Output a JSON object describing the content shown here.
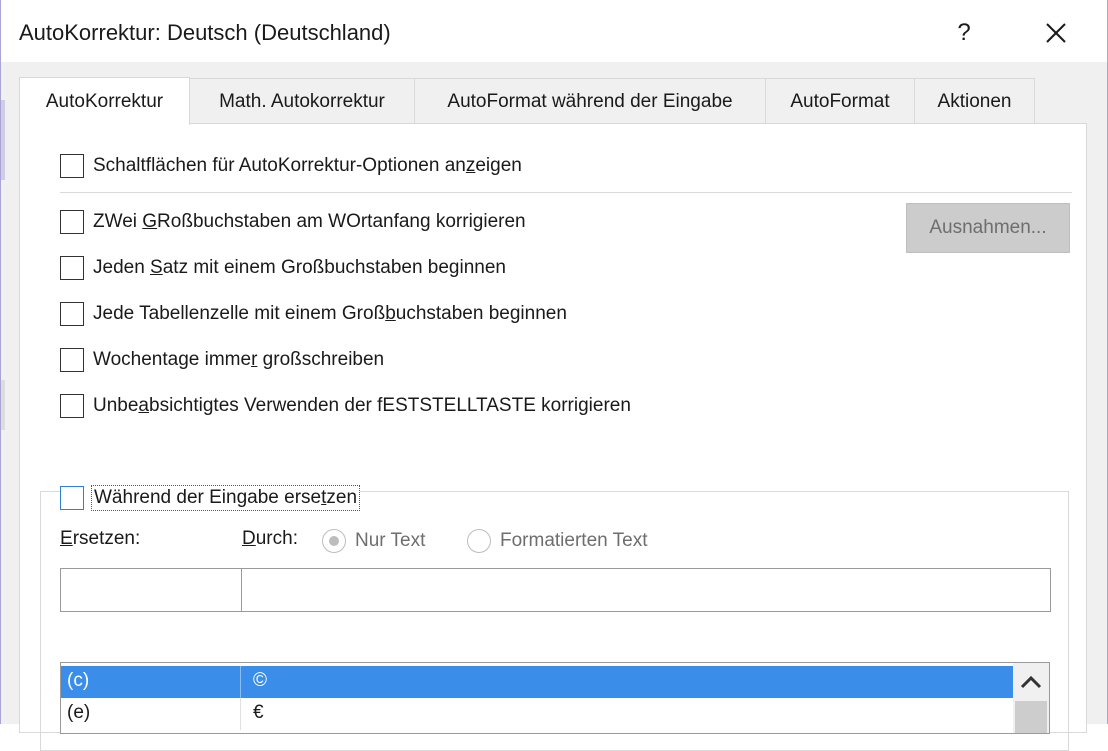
{
  "window": {
    "title": "AutoKorrektur: Deutsch (Deutschland)",
    "help_label": "?",
    "close_label": "✕"
  },
  "tabs": [
    {
      "label": "AutoKorrektur",
      "active": true
    },
    {
      "label": "Math. Autokorrektur",
      "active": false
    },
    {
      "label": "AutoFormat während der Eingabe",
      "active": false
    },
    {
      "label": "AutoFormat",
      "active": false
    },
    {
      "label": "Aktionen",
      "active": false
    }
  ],
  "options": {
    "show_buttons": {
      "before": "Schaltflächen für AutoKorrektur-Optionen an",
      "key": "z",
      "after": "eigen",
      "checked": false
    },
    "two_caps": {
      "before": "ZWei ",
      "key": "G",
      "after": "Roßbuchstaben am WOrtanfang korrigieren",
      "checked": false
    },
    "sentence_caps": {
      "before": "Jeden ",
      "key": "S",
      "after": "atz mit einem Großbuchstaben beginnen",
      "checked": false
    },
    "table_caps": {
      "before": "Jede Tabellenzelle mit einem Groß",
      "key": "b",
      "after": "uchstaben beginnen",
      "checked": false
    },
    "weekdays": {
      "before": "Wochentage imme",
      "key": "r",
      "after": " großschreiben",
      "checked": false
    },
    "caps_lock": {
      "before": "Unbe",
      "key": "a",
      "after": "bsichtigtes Verwenden der fESTSTELLTASTE korrigieren",
      "checked": false
    }
  },
  "exceptions_button": "Ausnahmen...",
  "replace_section": {
    "toggle": {
      "before": "Während der Eingabe erse",
      "key": "t",
      "after": "zen",
      "checked": false
    },
    "replace_label": {
      "key": "E",
      "after": "rsetzen:"
    },
    "with_label": {
      "key": "D",
      "after": "urch:"
    },
    "radio_plain": "Nur Text",
    "radio_formatted": "Formatierten Text",
    "replace_value": "",
    "with_value": ""
  },
  "list": {
    "rows": [
      {
        "replace": "(c)",
        "with": "©",
        "selected": true
      },
      {
        "replace": "(e)",
        "with": "€",
        "selected": false
      }
    ]
  },
  "icons": {
    "scroll_up": "chevron-up-icon"
  }
}
